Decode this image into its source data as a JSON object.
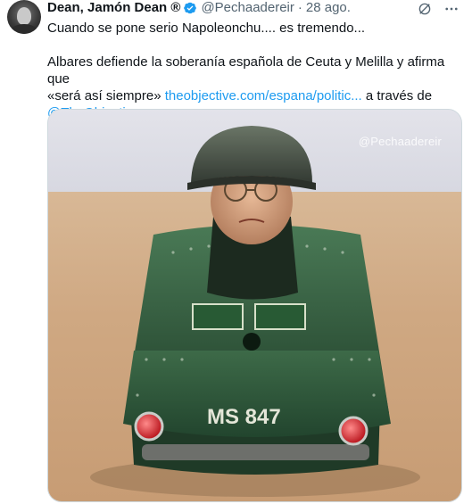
{
  "tweet": {
    "display_name": "Dean, Jamón Dean ®",
    "handle": "@Pechaadereir",
    "separator": "·",
    "time": "28 ago.",
    "text_line1": "Cuando se pone serio Napoleonchu....  es tremendo...",
    "text_line2": "Albares defiende la soberanía española de Ceuta y Melilla y afirma que",
    "text_line3_prefix": "«será así siempre» ",
    "link_url": "theobjective.com/espana/politic...",
    "text_line3_suffix": " a través de",
    "mention": "@TheObjective_es"
  },
  "media": {
    "watermark": "@Pechaadereir",
    "tank_plate": "MS 847"
  },
  "icons": {
    "verified": "verified-badge-icon",
    "grok": "grok-icon",
    "more": "more-icon"
  },
  "colors": {
    "link": "#1d9bf0",
    "secondary": "#536471",
    "verified": "#1d9bf0",
    "tank_green": "#2f5a3b"
  }
}
